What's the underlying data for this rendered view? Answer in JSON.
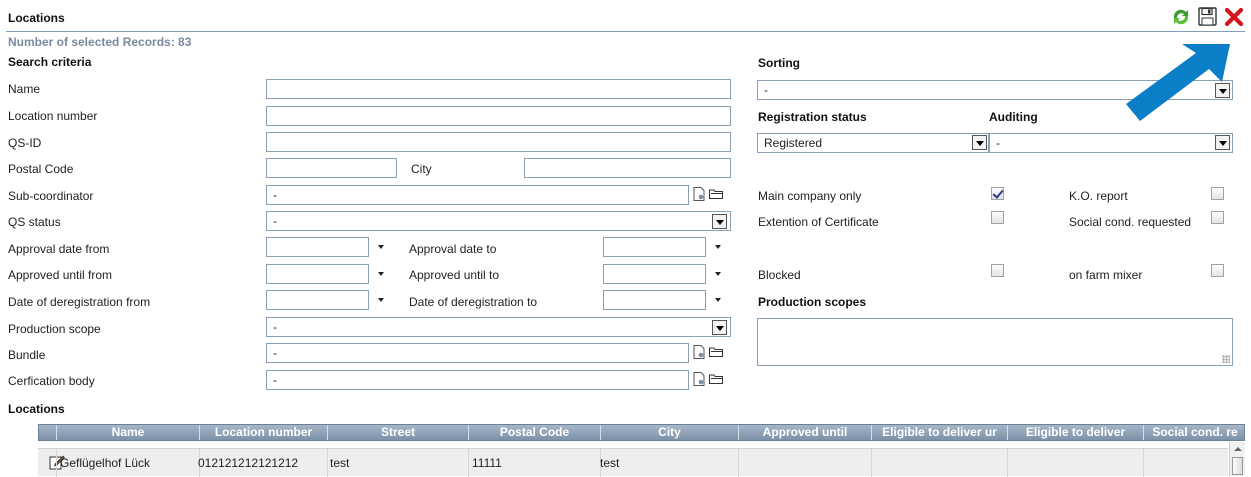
{
  "header": {
    "title": "Locations",
    "record_count": "Number of selected Records: 83"
  },
  "toolbar": {
    "refresh_icon": "refresh-arrows-icon",
    "save_icon": "floppy-disk-icon",
    "close_icon": "red-x-icon",
    "accent_refresh": "#3a9a2a",
    "accent_close": "#d4161c"
  },
  "search": {
    "heading": "Search criteria",
    "name_label": "Name",
    "name_value": "",
    "location_number_label": "Location number",
    "location_number_value": "",
    "qsid_label": "QS-ID",
    "qsid_value": "",
    "postal_code_label": "Postal Code",
    "postal_code_value": "",
    "city_label": "City",
    "city_value": "",
    "sub_coordinator_label": "Sub-coordinator",
    "sub_coordinator_value": "-",
    "qs_status_label": "QS status",
    "qs_status_value": "-",
    "approval_date_from_label": "Approval date from",
    "approval_date_to_label": "Approval date to",
    "approved_until_from_label": "Approved until from",
    "approved_until_to_label": "Approved until to",
    "dereg_from_label": "Date of deregistration from",
    "dereg_to_label": "Date of deregistration to",
    "production_scope_label": "Production scope",
    "production_scope_value": "-",
    "bundle_label": "Bundle",
    "bundle_value": "-",
    "cert_body_label": "Cerfication body",
    "cert_body_value": "-"
  },
  "right": {
    "sorting_heading": "Sorting",
    "sorting_value": "-",
    "registration_status_heading": "Registration status",
    "registration_status_value": "Registered",
    "auditing_heading": "Auditing",
    "auditing_value": "-",
    "main_company_only_label": "Main company only",
    "main_company_only_checked": true,
    "ko_report_label": "K.O. report",
    "ko_report_checked": false,
    "extention_label": "Extention of Certificate",
    "extention_checked": false,
    "social_cond_label": "Social cond. requested",
    "social_cond_checked": false,
    "blocked_label": "Blocked",
    "blocked_checked": false,
    "on_farm_mixer_label": "on farm mixer",
    "on_farm_mixer_checked": false,
    "production_scopes_heading": "Production scopes"
  },
  "grid": {
    "heading": "Locations",
    "columns": [
      "Name",
      "Location number",
      "Street",
      "Postal Code",
      "City",
      "Approved until",
      "Eligible to deliver ur",
      "Eligible to deliver",
      "Social cond. re"
    ],
    "rows": [
      {
        "name": "Geflügelhof Lück",
        "location_number": "012121212121212",
        "street": "test",
        "postal_code": "11111",
        "city": "test",
        "approved_until": "",
        "eligible_ur": "",
        "eligible": "",
        "social": ""
      }
    ]
  },
  "annotation": {
    "arrow_color": "#0a7fc8"
  }
}
